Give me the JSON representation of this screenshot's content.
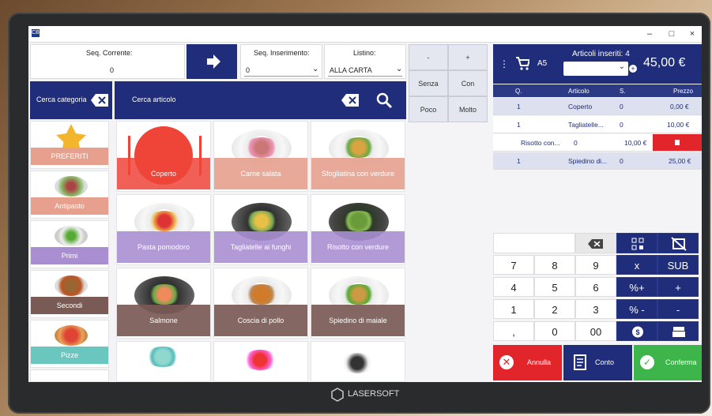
{
  "window": {
    "app_icon": "CB",
    "minimize": "–",
    "maximize": "□",
    "close": "×"
  },
  "header": {
    "seq_corrente_label": "Seq. Corrente:",
    "seq_corrente_value": "0",
    "seq_inserimento_label": "Seq. Inserimento:",
    "seq_inserimento_value": "0",
    "listino_label": "Listino:",
    "listino_value": "ALLA CARTA"
  },
  "modifiers": [
    "-",
    "+",
    "Senza",
    "Con",
    "Poco",
    "Molto"
  ],
  "search": {
    "category_placeholder": "Cerca categoria",
    "article_placeholder": "Cerca articolo"
  },
  "categories": [
    {
      "label": "PREFERITI",
      "color": "#e7a08d",
      "icon": "star-icon"
    },
    {
      "label": "Antipasto",
      "color": "#e7a08d"
    },
    {
      "label": "Primi",
      "color": "#a98fd1"
    },
    {
      "label": "Secondi",
      "color": "#7a5a55"
    },
    {
      "label": "Pizze",
      "color": "#6ac7c0"
    }
  ],
  "articles": [
    {
      "label": "Coperto",
      "color": "#ef4438"
    },
    {
      "label": "Carne salata",
      "color": "#e7a08d"
    },
    {
      "label": "Sfogliatina con verdure",
      "color": "#e7a08d"
    },
    {
      "label": "Pasta pomodoro",
      "color": "#a98fd1"
    },
    {
      "label": "Tagliatelle ai funghi",
      "color": "#a98fd1"
    },
    {
      "label": "Risotto con verdure",
      "color": "#a98fd1"
    },
    {
      "label": "Salmone",
      "color": "#7a5a55"
    },
    {
      "label": "Coscia di pollo",
      "color": "#7a5a55"
    },
    {
      "label": "Spiedino di maiale",
      "color": "#7a5a55"
    }
  ],
  "order": {
    "table": "A5",
    "inserted_label": "Articoli inseriti: 4",
    "total": "45,00 €",
    "columns": [
      "Q.",
      "Articolo",
      "S.",
      "Prezzo"
    ],
    "rows": [
      {
        "q": "1",
        "article": "Coperto",
        "s": "0",
        "price": "0,00 €"
      },
      {
        "q": "1",
        "article": "Tagliatelle...",
        "s": "0",
        "price": "10,00 €"
      },
      {
        "q": "",
        "article": "Risotto con...",
        "s": "0",
        "price": "10,00 €"
      },
      {
        "q": "1",
        "article": "Spiedino di...",
        "s": "0",
        "price": "25,00 €"
      }
    ]
  },
  "keypad": {
    "rows": [
      [
        "7",
        "8",
        "9",
        "x",
        "SUB"
      ],
      [
        "4",
        "5",
        "6",
        "%+",
        "+"
      ],
      [
        "1",
        "2",
        "3",
        "% -",
        "-"
      ],
      [
        ",",
        "0",
        "00"
      ]
    ]
  },
  "actions": {
    "annulla": "Annulla",
    "conto": "Conto",
    "conferma": "Conferma"
  },
  "brand": "LASERSOFT"
}
